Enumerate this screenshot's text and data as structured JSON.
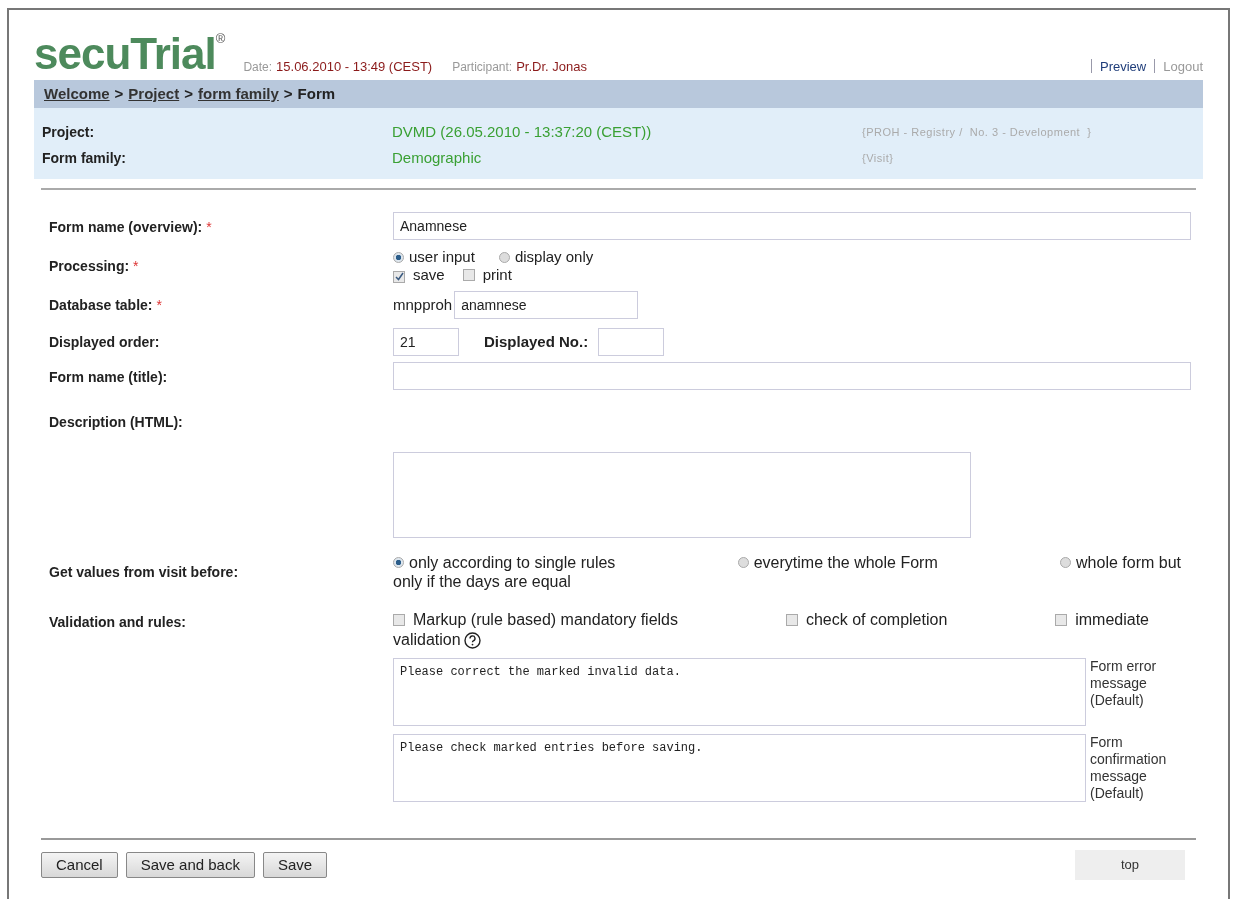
{
  "header": {
    "logo": "secuTrial",
    "logo_mark": "®",
    "date_label": "Date:",
    "date": "15.06.2010 - 13:49 (CEST)",
    "participant_label": "Participant:",
    "participant": "Pr.Dr. Jonas",
    "links": [
      "Preview",
      "Logout"
    ]
  },
  "breadcrumb": [
    {
      "label": "Welcome",
      "link": true
    },
    {
      "label": "Project",
      "link": true
    },
    {
      "label": "form family",
      "link": true
    },
    {
      "label": "Form",
      "link": false
    }
  ],
  "required_mark": "*",
  "breadcrumb_separator": ">",
  "info": [
    {
      "label": "Project:",
      "value": "DVMD (26.05.2010 - 13:37:20 (CEST))",
      "note": "{PROH - Registry /  No. 3 - Development  }"
    },
    {
      "label": "Form family:",
      "value": "Demographic",
      "note": "{Visit}"
    }
  ],
  "form": [
    {
      "kind": "text",
      "label": "Form name (overview):",
      "required": true,
      "value": "Anamnese"
    },
    {
      "kind": "processing",
      "label": "Processing:",
      "required": true,
      "radios": [
        {
          "label": "user input",
          "selected": true
        },
        {
          "label": "display only",
          "selected": false
        }
      ],
      "checks": [
        {
          "label": "save",
          "checked": true
        },
        {
          "label": "print",
          "checked": false
        }
      ]
    },
    {
      "kind": "prefixed",
      "label": "Database table:",
      "required": true,
      "prefix": "mnpproh",
      "value": "anamnese"
    },
    {
      "kind": "order",
      "label": "Displayed order:",
      "required": false,
      "value": "21",
      "second_label": "Displayed No.:"
    },
    {
      "kind": "text",
      "label": "Form name (title):",
      "required": false
    },
    {
      "kind": "textarea",
      "label": "Description (HTML):",
      "required": false
    },
    {
      "kind": "radios",
      "label": "Get values from visit before:",
      "required": false,
      "options": [
        {
          "label": "only according to single rules",
          "selected": true
        },
        {
          "label": "everytime the whole Form",
          "selected": false
        },
        {
          "label": "whole form but",
          "selected": false
        }
      ],
      "continuation": "only if the days are equal"
    },
    {
      "kind": "validation",
      "label": "Validation and rules:",
      "required": false,
      "options": [
        {
          "label": "Markup (rule based) mandatory fields",
          "checked": false
        },
        {
          "label": "check of completion",
          "checked": false
        },
        {
          "label": "immediate",
          "checked": false
        }
      ],
      "continuation": "validation",
      "messages": [
        {
          "value": "Please correct the marked invalid data.",
          "caption": "Form error message (Default)"
        },
        {
          "value": "Please check marked entries before saving.",
          "caption": "Form confirmation message (Default)"
        }
      ]
    }
  ],
  "buttons": [
    "Cancel",
    "Save and back",
    "Save"
  ],
  "top_link": "top"
}
